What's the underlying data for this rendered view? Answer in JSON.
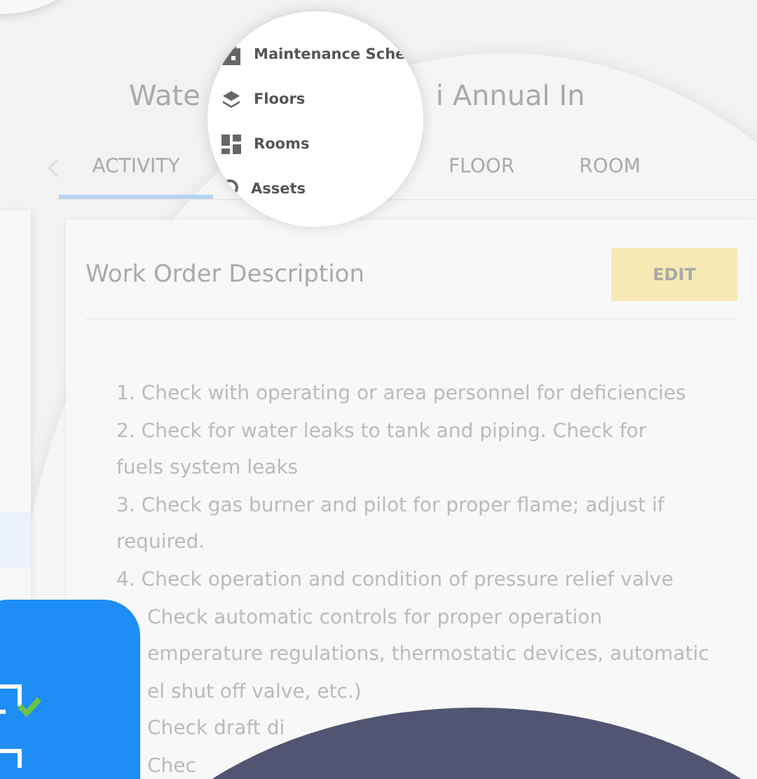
{
  "title_parts": [
    "Wate",
    "i Annual In"
  ],
  "tabs": [
    {
      "label": "ACTIVITY",
      "selected": true
    },
    {
      "label": "FLOOR",
      "selected": false
    },
    {
      "label": "ROOM",
      "selected": false
    }
  ],
  "card": {
    "title": "Work Order Description",
    "edit_button": "EDIT",
    "lines": [
      {
        "text": "1. Check with operating or area personnel for deficiencies",
        "partly_hidden": false
      },
      {
        "text": "2. Check for water leaks to tank and piping. Check for",
        "partly_hidden": false
      },
      {
        "text": "fuels system leaks",
        "partly_hidden": false
      },
      {
        "text": "3. Check gas burner and pilot for proper flame; adjust if",
        "partly_hidden": false
      },
      {
        "text": "required.",
        "partly_hidden": false
      },
      {
        "text": "4. Check operation and condition of pressure relief valve",
        "partly_hidden": false
      },
      {
        "text": "Check automatic controls for proper operation",
        "partly_hidden": true
      },
      {
        "text": "emperature regulations, thermostatic devices, automatic",
        "partly_hidden": true
      },
      {
        "text": "el shut off valve, etc.)",
        "partly_hidden": true
      },
      {
        "text": "Check draft di",
        "partly_hidden": true
      },
      {
        "text": "Chec",
        "partly_hidden": true
      }
    ]
  },
  "magnifier": {
    "items": [
      {
        "label": "Maintenance Sche"
      },
      {
        "label": "Floors"
      },
      {
        "label": "Rooms"
      },
      {
        "label": "Assets"
      }
    ]
  }
}
